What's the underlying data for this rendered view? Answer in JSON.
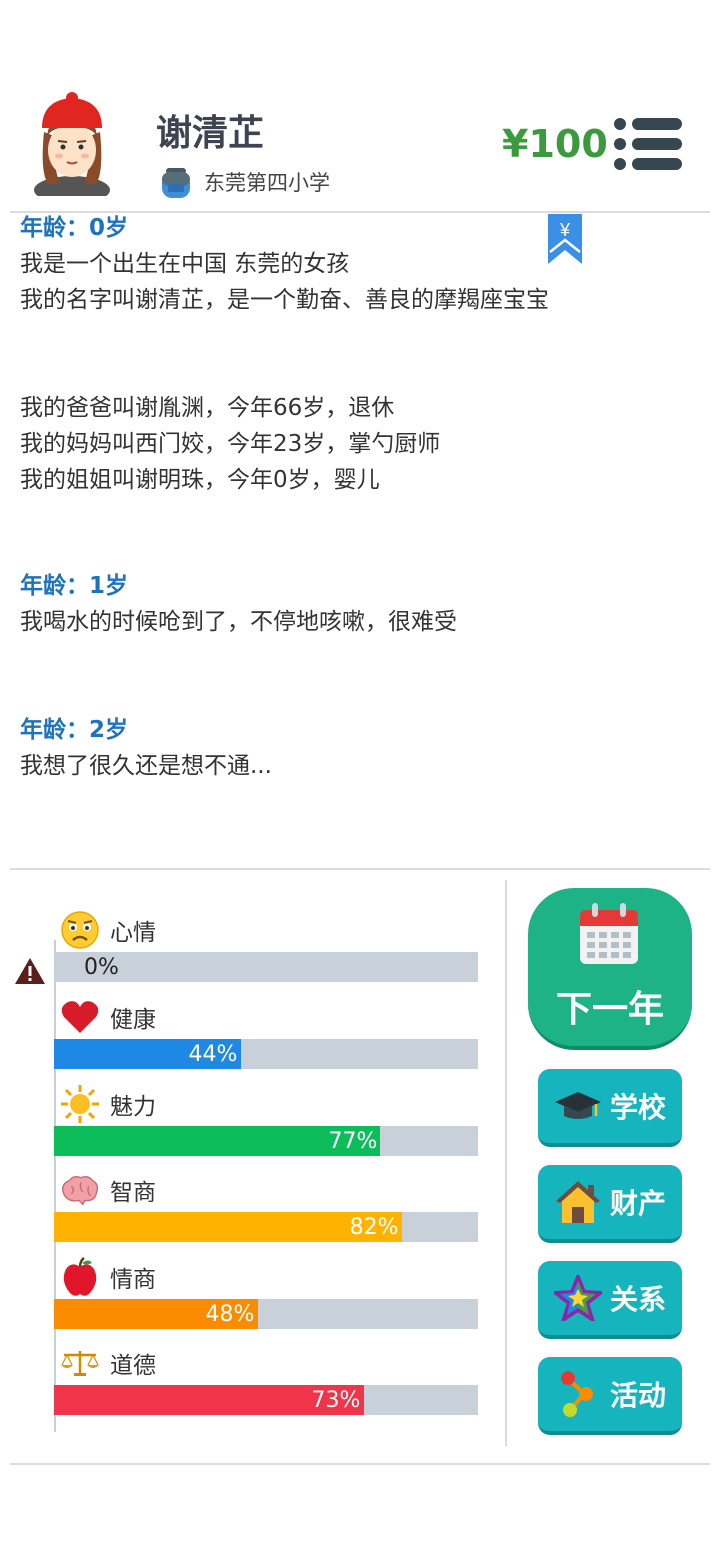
{
  "header": {
    "name": "谢清芷",
    "school": "东莞第四小学",
    "money": "¥100"
  },
  "log": [
    {
      "age": "年龄：0岁",
      "lines": [
        "我是一个出生在中国 东莞的女孩",
        "我的名字叫谢清芷，是一个勤奋、善良的摩羯座宝宝",
        "",
        "",
        "我的爸爸叫谢胤渊，今年66岁，退休",
        "我的妈妈叫西门姣，今年23岁，掌勺厨师",
        "我的姐姐叫谢明珠，今年0岁，婴儿"
      ]
    },
    {
      "age": "年龄：1岁",
      "lines": [
        "我喝水的时候呛到了，不停地咳嗽，很难受"
      ]
    },
    {
      "age": "年龄：2岁",
      "lines": [
        "我想了很久还是想不通..."
      ]
    }
  ],
  "bookmark_symbol": "¥",
  "stats": [
    {
      "icon": "sad-face-icon",
      "label": "心情",
      "value": 0,
      "text": "0%",
      "color": "#c8d0da"
    },
    {
      "icon": "heart-icon",
      "label": "健康",
      "value": 44,
      "text": "44%",
      "color": "#1e88e5"
    },
    {
      "icon": "sun-icon",
      "label": "魅力",
      "value": 77,
      "text": "77%",
      "color": "#0dbd5a"
    },
    {
      "icon": "brain-icon",
      "label": "智商",
      "value": 82,
      "text": "82%",
      "color": "#ffb300"
    },
    {
      "icon": "apple-icon",
      "label": "情商",
      "value": 48,
      "text": "48%",
      "color": "#fb8c00"
    },
    {
      "icon": "scale-icon",
      "label": "道德",
      "value": 73,
      "text": "73%",
      "color": "#f0344a"
    }
  ],
  "buttons": {
    "next_year": "下一年",
    "school": "学校",
    "property": "财产",
    "relations": "关系",
    "activity": "活动"
  },
  "colors": {
    "money": "#3c9a3e",
    "age": "#1e73be",
    "next_button": "#1db387",
    "action_button": "#16b5bd"
  }
}
